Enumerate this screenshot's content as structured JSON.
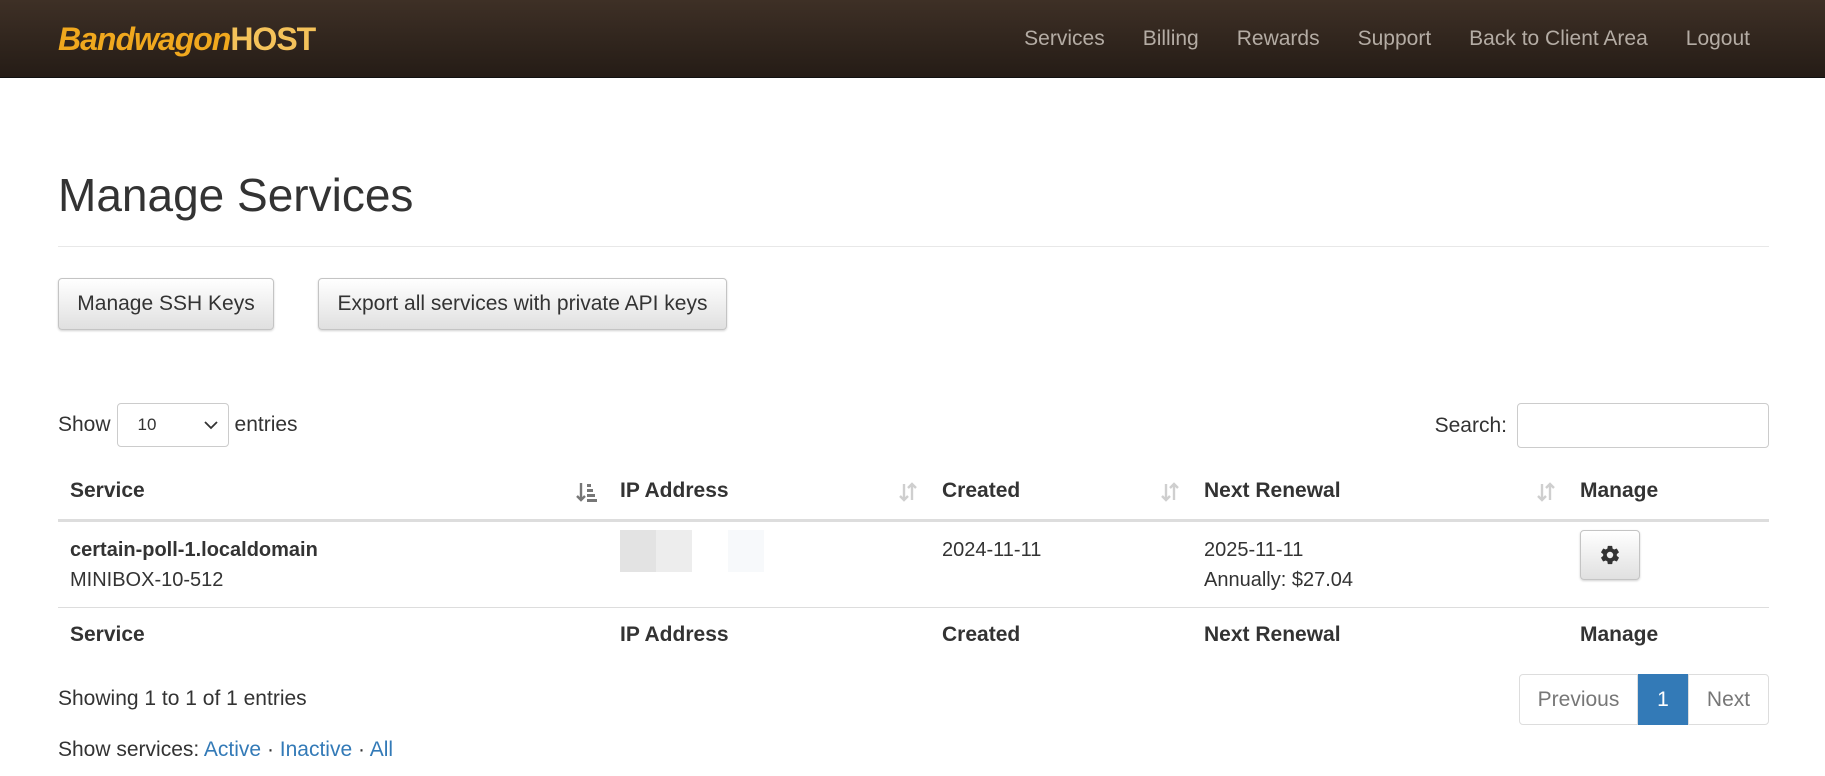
{
  "brand": {
    "part1": "Bandwagon",
    "part2": "HOST"
  },
  "nav": {
    "items": [
      "Services",
      "Billing",
      "Rewards",
      "Support",
      "Back to Client Area",
      "Logout"
    ]
  },
  "page": {
    "title": "Manage Services"
  },
  "buttons": {
    "ssh": "Manage SSH Keys",
    "export": "Export all services with private API keys"
  },
  "length": {
    "show": "Show",
    "value": "10",
    "entries": "entries"
  },
  "search": {
    "label": "Search:",
    "value": ""
  },
  "table": {
    "columns": [
      "Service",
      "IP Address",
      "Created",
      "Next Renewal",
      "Manage"
    ],
    "rows": [
      {
        "service": "certain-poll-1.localdomain",
        "plan": "MINIBOX-10-512",
        "created": "2024-11-11",
        "renewal": "2025-11-11",
        "price": "Annually: $27.04"
      }
    ]
  },
  "info": "Showing 1 to 1 of 1 entries",
  "pagination": {
    "previous": "Previous",
    "current": "1",
    "next": "Next"
  },
  "filter": {
    "label": "Show services:",
    "active": "Active",
    "inactive": "Inactive",
    "all": "All",
    "sep": "·"
  },
  "colors": {
    "accent": "#337ab7",
    "brand_orange": "#f0a81e",
    "navbar": "#2e241d"
  }
}
